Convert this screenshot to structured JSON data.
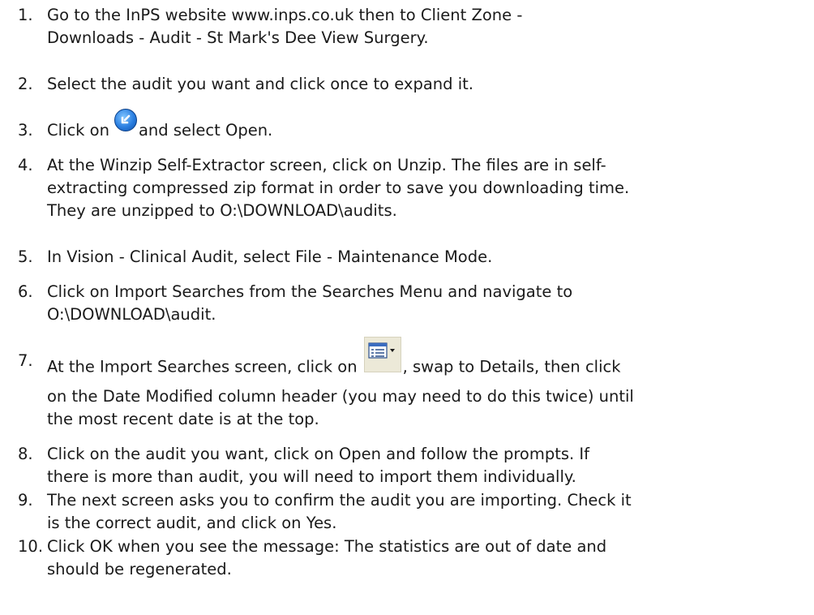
{
  "steps": [
    {
      "number": "1.",
      "lines": [
        "Go to the InPS website www.inps.co.uk then to Client Zone -",
        "Downloads - Audit - St Mark's Dee View Surgery."
      ]
    },
    {
      "number": "2.",
      "lines": [
        "Select the audit you want and click once to expand it."
      ]
    },
    {
      "number": "3.",
      "before_icon": "Click on",
      "icon": "download-round-icon",
      "after_icon": "and select Open."
    },
    {
      "number": "4.",
      "lines": [
        "At the Winzip Self-Extractor screen, click on Unzip.  The files are in self-",
        "extracting compressed zip format in order to save you downloading time.",
        "They are unzipped to O:\\DOWNLOAD\\audits."
      ]
    },
    {
      "number": "5.",
      "lines": [
        "In Vision - Clinical Audit, select File - Maintenance Mode."
      ]
    },
    {
      "number": "6.",
      "lines": [
        "Click on Import Searches from the Searches Menu and navigate to",
        "O:\\DOWNLOAD\\audit."
      ]
    },
    {
      "number": "7.",
      "before_icon": "At the Import Searches screen, click on",
      "icon": "view-menu-icon",
      "after_icon": ", swap to Details, then click",
      "lines": [
        "on the Date Modified column header (you may need to do this twice) until",
        "the most recent date is at the top."
      ]
    },
    {
      "number": "8.",
      "lines": [
        "Click on the audit you want, click on Open and follow the prompts.  If",
        "there is more than audit, you will need to import them individually."
      ]
    },
    {
      "number": "9.",
      "lines": [
        "The next screen asks you to confirm the audit you are importing.  Check it",
        "is the correct audit, and click on Yes."
      ]
    },
    {
      "number": "10.",
      "lines": [
        "Click OK when you see the message: The statistics are out of date and",
        "should be regenerated."
      ]
    }
  ]
}
